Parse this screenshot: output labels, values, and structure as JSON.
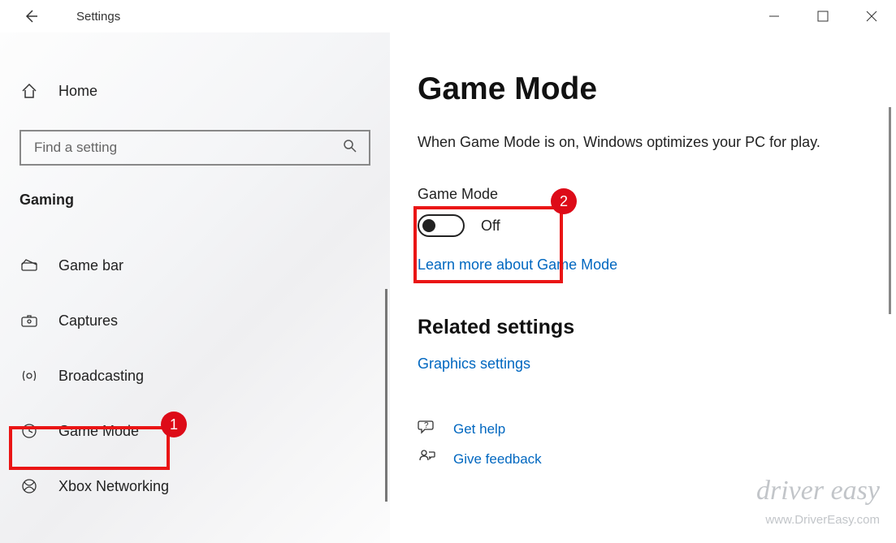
{
  "title": "Settings",
  "sidebar": {
    "home_label": "Home",
    "search_placeholder": "Find a setting",
    "category": "Gaming",
    "items": [
      {
        "icon": "game-bar-icon",
        "label": "Game bar"
      },
      {
        "icon": "captures-icon",
        "label": "Captures"
      },
      {
        "icon": "broadcasting-icon",
        "label": "Broadcasting"
      },
      {
        "icon": "game-mode-icon",
        "label": "Game Mode"
      },
      {
        "icon": "xbox-networking-icon",
        "label": "Xbox Networking"
      }
    ]
  },
  "main": {
    "page_title": "Game Mode",
    "description": "When Game Mode is on, Windows optimizes your PC for play.",
    "setting_label": "Game Mode",
    "toggle_state": "Off",
    "learn_more": "Learn more about Game Mode",
    "related_title": "Related settings",
    "related_link": "Graphics settings",
    "help_link": "Get help",
    "feedback_link": "Give feedback"
  },
  "annotations": {
    "badge1": "1",
    "badge2": "2"
  },
  "watermark": {
    "line1": "driver easy",
    "line2": "www.DriverEasy.com"
  }
}
